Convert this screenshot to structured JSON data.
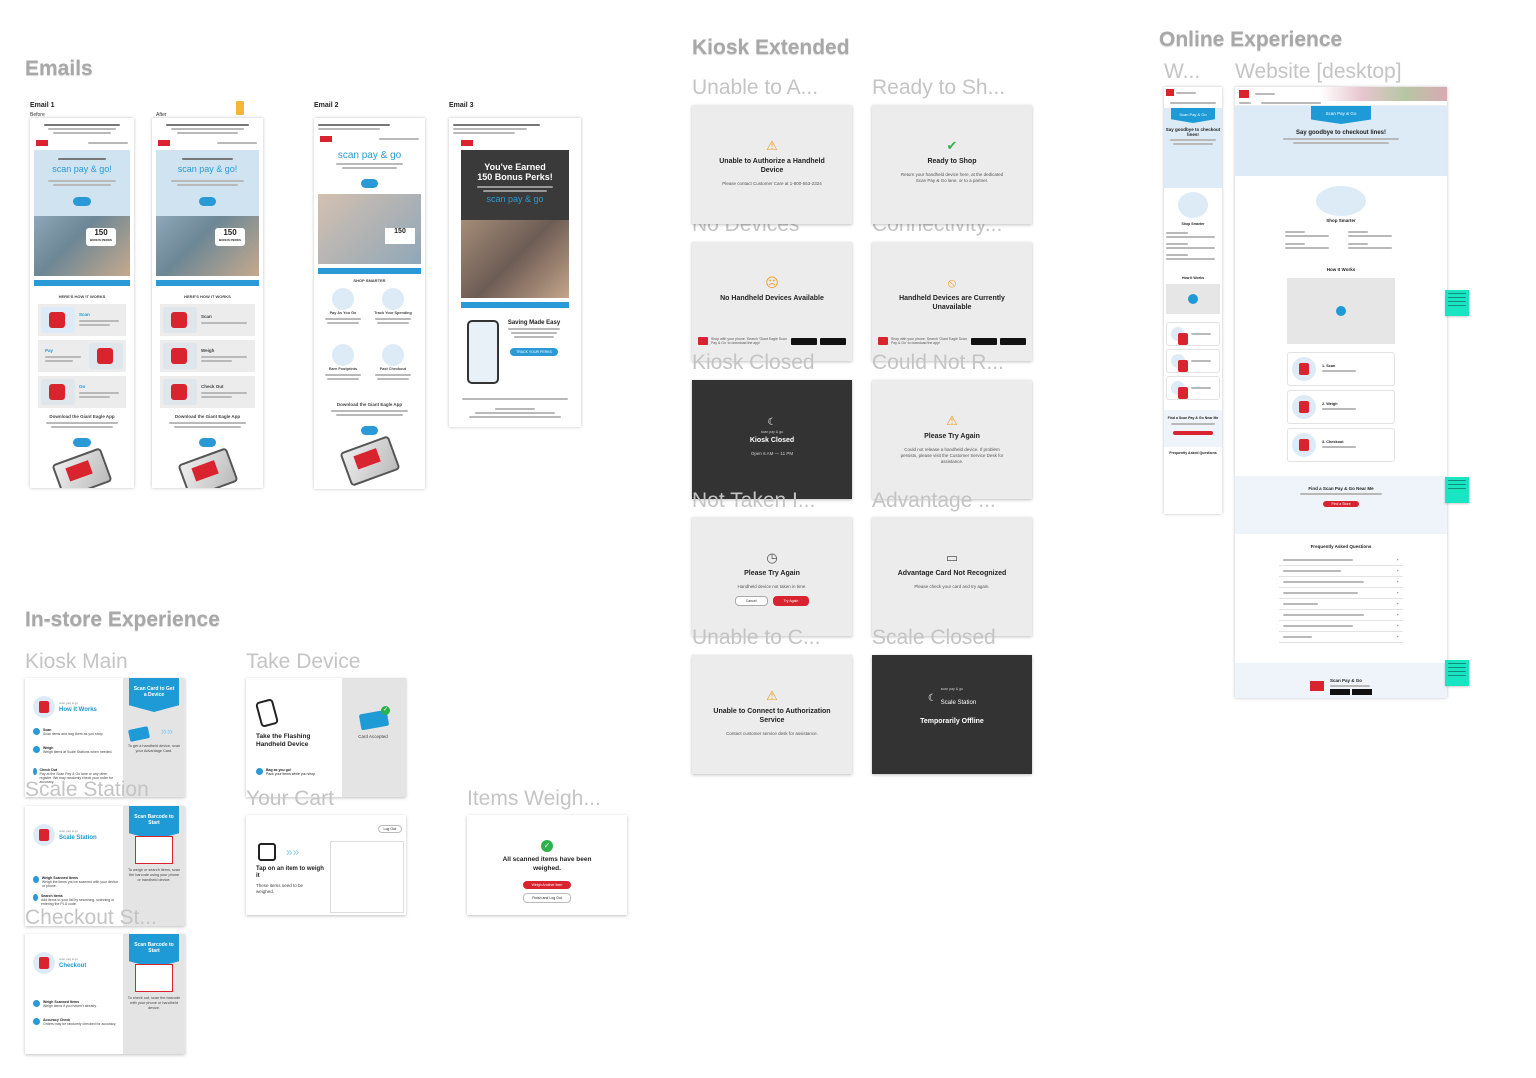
{
  "sections": {
    "emails": "Emails",
    "in_store": "In-store Experience",
    "kiosk_extended": "Kiosk Extended",
    "online": "Online Experience"
  },
  "colors": {
    "brand_red": "#d9242f",
    "brand_blue": "#1e9ad6",
    "sticky_note": "#19e5c2",
    "section_title": "#a8a8a8"
  },
  "emails": {
    "email1": {
      "label": "Email 1",
      "before": "Before",
      "after": "After"
    },
    "email2": {
      "label": "Email 2",
      "hero_title": "scan pay & go",
      "shop_smarter": "SHOP SMARTER",
      "download_title": "Download the Giant Eagle App",
      "cards": [
        "Pay As You Go",
        "Track Your Spending",
        "Earn Footprints",
        "Fast Checkout"
      ]
    },
    "email3": {
      "label": "Email 3",
      "hero_line1": "You've Earned",
      "hero_line2": "150 Bonus Perks!",
      "brand": "scan pay & go",
      "saving_title": "Saving Made Easy",
      "cta": "TRACK YOUR PERKS"
    },
    "hero_text": "scan pay & go!",
    "perks_num": "150",
    "perks_label": "BONUS PERKS",
    "how_it_works": "HERE'S HOW IT WORKS",
    "download_title": "Download the Giant Eagle App",
    "before_steps": [
      "Scan",
      "Pay",
      "Go"
    ],
    "after_steps": [
      "Scan",
      "Weigh",
      "Check Out"
    ]
  },
  "kiosk_tiles": [
    {
      "frame": "Unable to A...",
      "title": "Unable to Authorize a Handheld Device",
      "message": "Please contact Customer Care at 1-800-553-2324",
      "icon": "warning-icon"
    },
    {
      "frame": "Ready to Sh...",
      "title": "Ready to Shop",
      "message": "Return your handheld device here, at the dedicated Scan Pay & Go lane, or to a partner.",
      "icon": "check-icon"
    },
    {
      "frame": "No Devices",
      "title": "No Handheld Devices Available",
      "message": "Shop with your phone. Search 'Giant Eagle Scan Pay & Go' to download the app!",
      "icon": "frown-icon"
    },
    {
      "frame": "Connectivity...",
      "title": "Handheld Devices are Currently Unavailable",
      "message": "Shop with your phone. Search 'Giant Eagle Scan Pay & Go' to download the app!",
      "icon": "no-entry-icon"
    },
    {
      "frame": "Kiosk Closed",
      "title": "Kiosk Closed",
      "subtitle": "scan pay & go",
      "message": "Open 6 AM — 11 PM",
      "icon": "moon-icon"
    },
    {
      "frame": "Could Not R...",
      "title": "Please Try Again",
      "message": "Could not release a handheld device. If problem persists, please visit the Customer Service Desk for assistance.",
      "icon": "warning-icon"
    },
    {
      "frame": "Not Taken I...",
      "title": "Please Try Again",
      "message": "Handheld device not taken in time.",
      "icon": "clock-icon",
      "buttons": [
        "Cancel",
        "Try Again"
      ]
    },
    {
      "frame": "Advantage ...",
      "title": "Advantage Card Not Recognized",
      "message": "Please check your card and try again.",
      "icon": "card-icon"
    },
    {
      "frame": "Unable to C...",
      "title": "Unable to Connect to Authorization Service",
      "message": "Contact customer service desk for assistance.",
      "icon": "warning-icon"
    },
    {
      "frame": "Scale Closed",
      "title": "Temporarily Offline",
      "subtitle": "Scale Station",
      "subtitle_small": "scan pay & go",
      "icon": "moon-icon"
    }
  ],
  "in_store": {
    "kiosk_main": {
      "frame": "Kiosk Main",
      "header": "How It Works",
      "small": "scan pay & go",
      "banner": "Scan Card to Get a Device",
      "caption": "To get a handheld device, scan your Advantage Card.",
      "steps": [
        {
          "t": "Scan",
          "d": "Scan items and bag them as you shop."
        },
        {
          "t": "Weigh",
          "d": "Weigh items at Scale Stations when needed."
        },
        {
          "t": "Check Out",
          "d": "Pay at the Scan Pay & Go lane or any other register. We may randomly check your order for accuracy."
        }
      ]
    },
    "take_device": {
      "frame": "Take Device",
      "title": "Take the Flashing Handheld Device",
      "card_accepted": "Card Accepted",
      "foot_title": "Bag as you go!",
      "foot_sub": "Pack your items while you shop."
    },
    "scale_station": {
      "frame": "Scale Station",
      "header": "Scale Station",
      "small": "scan pay & go",
      "banner": "Scan Barcode to Start",
      "caption": "To weigh or search items, scan the barcode using your phone or handheld device.",
      "steps": [
        {
          "t": "Weigh Scanned Items",
          "d": "Weigh the items you've scanned with your device or phone."
        },
        {
          "t": "Search Items",
          "d": "Add items to your list by searching, scanning or entering the PLU code."
        }
      ]
    },
    "your_cart": {
      "frame": "Your Cart",
      "title": "Tap on an item to weigh it",
      "desc": "These items need to be weighed.",
      "log_out": "Log Out"
    },
    "items_weighed": {
      "frame": "Items Weigh...",
      "title": "All scanned items have been weighed.",
      "btn_primary": "Weigh Another Item",
      "btn_secondary": "Finish and Log Out"
    },
    "checkout": {
      "frame": "Checkout St...",
      "header": "Checkout",
      "small": "scan pay & go",
      "banner": "Scan Barcode to Start",
      "caption": "To check out, scan the barcode with your phone or handheld device.",
      "steps": [
        {
          "t": "Weigh Scanned Items",
          "d": "Weigh items if you haven't already."
        },
        {
          "t": "Accuracy Check",
          "d": "Orders may be randomly checked for accuracy."
        }
      ]
    }
  },
  "online": {
    "mobile_frame": "W...",
    "desktop_frame": "Website [desktop]",
    "badge": "Scan Pay & Go",
    "headline": "Say goodbye to checkout lines!",
    "shop_smarter": "Shop Smarter",
    "how_it_works": "How It Works",
    "steps": [
      "1. Scan",
      "2. Weigh",
      "3. Checkout"
    ],
    "find_title": "Find a Scan Pay & Go Near Me",
    "find_btn": "Find a Store",
    "faq_title": "Frequently Asked Questions",
    "mobile_faq_title": "Frequently Asked Questions",
    "faq_count": 9,
    "footer_title": "Scan Pay & Go",
    "mobile_find_title": "Find a Scan Pay & Go Near Me"
  }
}
